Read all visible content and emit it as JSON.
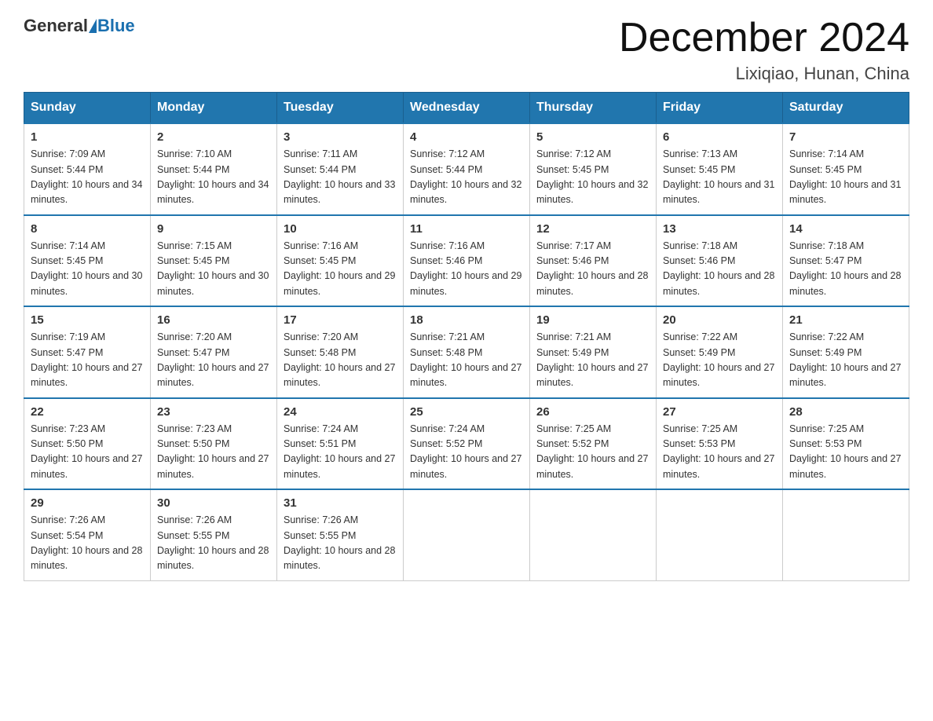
{
  "header": {
    "logo_general": "General",
    "logo_blue": "Blue",
    "month_title": "December 2024",
    "location": "Lixiqiao, Hunan, China"
  },
  "days_of_week": [
    "Sunday",
    "Monday",
    "Tuesday",
    "Wednesday",
    "Thursday",
    "Friday",
    "Saturday"
  ],
  "weeks": [
    [
      {
        "day": "1",
        "sunrise": "7:09 AM",
        "sunset": "5:44 PM",
        "daylight": "10 hours and 34 minutes."
      },
      {
        "day": "2",
        "sunrise": "7:10 AM",
        "sunset": "5:44 PM",
        "daylight": "10 hours and 34 minutes."
      },
      {
        "day": "3",
        "sunrise": "7:11 AM",
        "sunset": "5:44 PM",
        "daylight": "10 hours and 33 minutes."
      },
      {
        "day": "4",
        "sunrise": "7:12 AM",
        "sunset": "5:44 PM",
        "daylight": "10 hours and 32 minutes."
      },
      {
        "day": "5",
        "sunrise": "7:12 AM",
        "sunset": "5:45 PM",
        "daylight": "10 hours and 32 minutes."
      },
      {
        "day": "6",
        "sunrise": "7:13 AM",
        "sunset": "5:45 PM",
        "daylight": "10 hours and 31 minutes."
      },
      {
        "day": "7",
        "sunrise": "7:14 AM",
        "sunset": "5:45 PM",
        "daylight": "10 hours and 31 minutes."
      }
    ],
    [
      {
        "day": "8",
        "sunrise": "7:14 AM",
        "sunset": "5:45 PM",
        "daylight": "10 hours and 30 minutes."
      },
      {
        "day": "9",
        "sunrise": "7:15 AM",
        "sunset": "5:45 PM",
        "daylight": "10 hours and 30 minutes."
      },
      {
        "day": "10",
        "sunrise": "7:16 AM",
        "sunset": "5:45 PM",
        "daylight": "10 hours and 29 minutes."
      },
      {
        "day": "11",
        "sunrise": "7:16 AM",
        "sunset": "5:46 PM",
        "daylight": "10 hours and 29 minutes."
      },
      {
        "day": "12",
        "sunrise": "7:17 AM",
        "sunset": "5:46 PM",
        "daylight": "10 hours and 28 minutes."
      },
      {
        "day": "13",
        "sunrise": "7:18 AM",
        "sunset": "5:46 PM",
        "daylight": "10 hours and 28 minutes."
      },
      {
        "day": "14",
        "sunrise": "7:18 AM",
        "sunset": "5:47 PM",
        "daylight": "10 hours and 28 minutes."
      }
    ],
    [
      {
        "day": "15",
        "sunrise": "7:19 AM",
        "sunset": "5:47 PM",
        "daylight": "10 hours and 27 minutes."
      },
      {
        "day": "16",
        "sunrise": "7:20 AM",
        "sunset": "5:47 PM",
        "daylight": "10 hours and 27 minutes."
      },
      {
        "day": "17",
        "sunrise": "7:20 AM",
        "sunset": "5:48 PM",
        "daylight": "10 hours and 27 minutes."
      },
      {
        "day": "18",
        "sunrise": "7:21 AM",
        "sunset": "5:48 PM",
        "daylight": "10 hours and 27 minutes."
      },
      {
        "day": "19",
        "sunrise": "7:21 AM",
        "sunset": "5:49 PM",
        "daylight": "10 hours and 27 minutes."
      },
      {
        "day": "20",
        "sunrise": "7:22 AM",
        "sunset": "5:49 PM",
        "daylight": "10 hours and 27 minutes."
      },
      {
        "day": "21",
        "sunrise": "7:22 AM",
        "sunset": "5:49 PM",
        "daylight": "10 hours and 27 minutes."
      }
    ],
    [
      {
        "day": "22",
        "sunrise": "7:23 AM",
        "sunset": "5:50 PM",
        "daylight": "10 hours and 27 minutes."
      },
      {
        "day": "23",
        "sunrise": "7:23 AM",
        "sunset": "5:50 PM",
        "daylight": "10 hours and 27 minutes."
      },
      {
        "day": "24",
        "sunrise": "7:24 AM",
        "sunset": "5:51 PM",
        "daylight": "10 hours and 27 minutes."
      },
      {
        "day": "25",
        "sunrise": "7:24 AM",
        "sunset": "5:52 PM",
        "daylight": "10 hours and 27 minutes."
      },
      {
        "day": "26",
        "sunrise": "7:25 AM",
        "sunset": "5:52 PM",
        "daylight": "10 hours and 27 minutes."
      },
      {
        "day": "27",
        "sunrise": "7:25 AM",
        "sunset": "5:53 PM",
        "daylight": "10 hours and 27 minutes."
      },
      {
        "day": "28",
        "sunrise": "7:25 AM",
        "sunset": "5:53 PM",
        "daylight": "10 hours and 27 minutes."
      }
    ],
    [
      {
        "day": "29",
        "sunrise": "7:26 AM",
        "sunset": "5:54 PM",
        "daylight": "10 hours and 28 minutes."
      },
      {
        "day": "30",
        "sunrise": "7:26 AM",
        "sunset": "5:55 PM",
        "daylight": "10 hours and 28 minutes."
      },
      {
        "day": "31",
        "sunrise": "7:26 AM",
        "sunset": "5:55 PM",
        "daylight": "10 hours and 28 minutes."
      },
      null,
      null,
      null,
      null
    ]
  ]
}
